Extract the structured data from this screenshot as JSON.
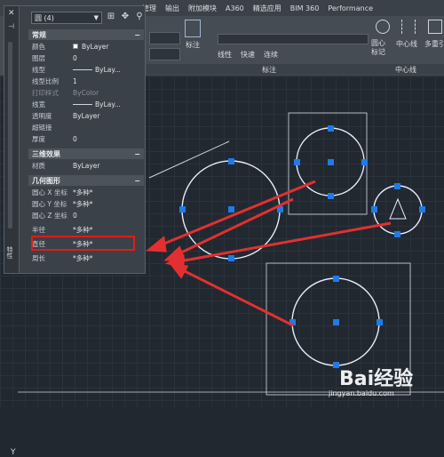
{
  "menu_tabs": [
    "管理",
    "输出",
    "附加模块",
    "A360",
    "精选应用",
    "BIM 360",
    "Performance"
  ],
  "ribbon": {
    "annotation_btn": "标注",
    "linetype_label": "线性",
    "quick_label": "快速",
    "continue_label": "连续",
    "annotation_group": "标注",
    "center_mark": "圆心标记",
    "center_line": "中心线",
    "centerline_group": "中心线",
    "multi_leader": "多重引线"
  },
  "palette": {
    "selection": "圆 (4)",
    "sections": {
      "general": "常规",
      "three_d": "三维效果",
      "geometry": "几何图形"
    },
    "general_rows": [
      {
        "key": "颜色",
        "value": "ByLayer"
      },
      {
        "key": "图层",
        "value": "0"
      },
      {
        "key": "线型",
        "value": "ByLay..."
      },
      {
        "key": "线型比例",
        "value": "1"
      },
      {
        "key": "打印样式",
        "value": "ByColor"
      },
      {
        "key": "线宽",
        "value": "ByLay..."
      },
      {
        "key": "透明度",
        "value": "ByLayer"
      },
      {
        "key": "超链接",
        "value": ""
      },
      {
        "key": "厚度",
        "value": "0"
      }
    ],
    "three_d_rows": [
      {
        "key": "材质",
        "value": "ByLayer"
      }
    ],
    "geometry_rows": [
      {
        "key": "圆心 X 坐标",
        "value": "*多种*"
      },
      {
        "key": "圆心 Y 坐标",
        "value": "*多种*"
      },
      {
        "key": "圆心 Z 坐标",
        "value": "0"
      },
      {
        "key": "半径",
        "value": "*多种*"
      },
      {
        "key": "直径",
        "value": "*多种*"
      },
      {
        "key": "周长",
        "value": "*多种*"
      }
    ],
    "side_title": "特性"
  },
  "canvas": {
    "ucs_label": "Y"
  },
  "watermark": {
    "logo": "Bai经验",
    "url": "jingyan.baidu.com"
  }
}
